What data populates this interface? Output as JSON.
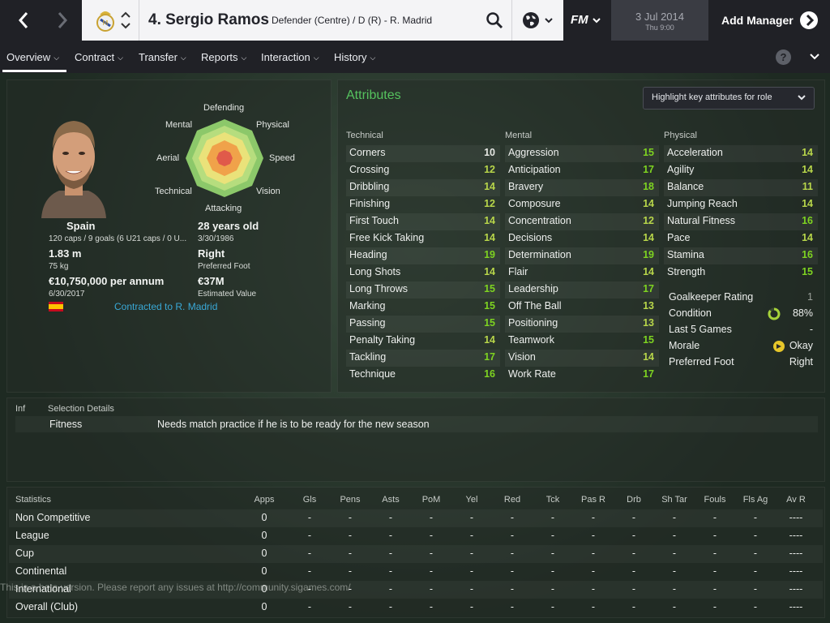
{
  "header": {
    "player_name": "4. Sergio Ramos",
    "position": "Defender (Centre) / D (R) - R. Madrid",
    "fm_logo": "FM",
    "date": "3 Jul 2014",
    "time": "Thu 9:00",
    "add_manager": "Add Manager"
  },
  "menu": [
    {
      "label": "Overview",
      "active": true
    },
    {
      "label": "Contract"
    },
    {
      "label": "Transfer"
    },
    {
      "label": "Reports"
    },
    {
      "label": "Interaction"
    },
    {
      "label": "History"
    }
  ],
  "help_label": "?",
  "profile": {
    "radar_labels": {
      "defending": "Defending",
      "physical": "Physical",
      "speed": "Speed",
      "vision": "Vision",
      "attacking": "Attacking",
      "technical": "Technical",
      "aerial": "Aerial",
      "mental": "Mental"
    },
    "nationality": "Spain",
    "caps": "120 caps / 9 goals (6 U21 caps / 0 U...",
    "height": "1.83 m",
    "weight": "75 kg",
    "wage": "€10,750,000 per annum",
    "contract_end": "6/30/2017",
    "age": "28 years old",
    "dob": "3/30/1986",
    "preferred_foot": "Right",
    "preferred_foot_label": "Preferred Foot",
    "value": "€37M",
    "value_label": "Estimated Value",
    "contracted": "Contracted to R. Madrid"
  },
  "attributes": {
    "title": "Attributes",
    "highlight_button": "Highlight key attributes for role",
    "technical": {
      "heading": "Technical",
      "items": [
        {
          "name": "Corners",
          "value": "10"
        },
        {
          "name": "Crossing",
          "value": "12"
        },
        {
          "name": "Dribbling",
          "value": "14"
        },
        {
          "name": "Finishing",
          "value": "12"
        },
        {
          "name": "First Touch",
          "value": "14"
        },
        {
          "name": "Free Kick Taking",
          "value": "14"
        },
        {
          "name": "Heading",
          "value": "19"
        },
        {
          "name": "Long Shots",
          "value": "14"
        },
        {
          "name": "Long Throws",
          "value": "15"
        },
        {
          "name": "Marking",
          "value": "15"
        },
        {
          "name": "Passing",
          "value": "15"
        },
        {
          "name": "Penalty Taking",
          "value": "14"
        },
        {
          "name": "Tackling",
          "value": "17"
        },
        {
          "name": "Technique",
          "value": "16"
        }
      ]
    },
    "mental": {
      "heading": "Mental",
      "items": [
        {
          "name": "Aggression",
          "value": "15"
        },
        {
          "name": "Anticipation",
          "value": "17"
        },
        {
          "name": "Bravery",
          "value": "18"
        },
        {
          "name": "Composure",
          "value": "14"
        },
        {
          "name": "Concentration",
          "value": "12"
        },
        {
          "name": "Decisions",
          "value": "14"
        },
        {
          "name": "Determination",
          "value": "19"
        },
        {
          "name": "Flair",
          "value": "14"
        },
        {
          "name": "Leadership",
          "value": "17"
        },
        {
          "name": "Off The Ball",
          "value": "13"
        },
        {
          "name": "Positioning",
          "value": "13"
        },
        {
          "name": "Teamwork",
          "value": "15"
        },
        {
          "name": "Vision",
          "value": "14"
        },
        {
          "name": "Work Rate",
          "value": "17"
        }
      ]
    },
    "physical": {
      "heading": "Physical",
      "items": [
        {
          "name": "Acceleration",
          "value": "14"
        },
        {
          "name": "Agility",
          "value": "14"
        },
        {
          "name": "Balance",
          "value": "11"
        },
        {
          "name": "Jumping Reach",
          "value": "14"
        },
        {
          "name": "Natural Fitness",
          "value": "16"
        },
        {
          "name": "Pace",
          "value": "14"
        },
        {
          "name": "Stamina",
          "value": "16"
        },
        {
          "name": "Strength",
          "value": "15"
        }
      ]
    },
    "summary": [
      {
        "name": "Goalkeeper Rating",
        "value": "1"
      },
      {
        "name": "Condition",
        "value": "88%"
      },
      {
        "name": "Last 5 Games",
        "value": "-"
      },
      {
        "name": "Morale",
        "value": "Okay"
      },
      {
        "name": "Preferred Foot",
        "value": "Right"
      }
    ]
  },
  "info": {
    "col1": "Inf",
    "col2": "Selection Details",
    "row_label": "Fitness",
    "row_text": "Needs match practice if he is to be ready for the new season"
  },
  "stats": {
    "title": "Statistics",
    "columns": [
      "Apps",
      "Gls",
      "Pens",
      "Asts",
      "PoM",
      "Yel",
      "Red",
      "Tck",
      "Pas R",
      "Drb",
      "Sh Tar",
      "Fouls",
      "Fls Ag",
      "Av R"
    ],
    "rows": [
      {
        "label": "Non Competitive",
        "cells": [
          "0",
          "-",
          "-",
          "-",
          "-",
          "-",
          "-",
          "-",
          "-",
          "-",
          "-",
          "-",
          "-",
          "----"
        ]
      },
      {
        "label": "League",
        "cells": [
          "0",
          "-",
          "-",
          "-",
          "-",
          "-",
          "-",
          "-",
          "-",
          "-",
          "-",
          "-",
          "-",
          "----"
        ]
      },
      {
        "label": "Cup",
        "cells": [
          "0",
          "-",
          "-",
          "-",
          "-",
          "-",
          "-",
          "-",
          "-",
          "-",
          "-",
          "-",
          "-",
          "----"
        ]
      },
      {
        "label": "Continental",
        "cells": [
          "0",
          "-",
          "-",
          "-",
          "-",
          "-",
          "-",
          "-",
          "-",
          "-",
          "-",
          "-",
          "-",
          "----"
        ]
      },
      {
        "label": "International",
        "cells": [
          "0",
          "-",
          "-",
          "-",
          "-",
          "-",
          "-",
          "-",
          "-",
          "-",
          "-",
          "-",
          "-",
          "----"
        ]
      },
      {
        "label": "Overall (Club)",
        "cells": [
          "0",
          "-",
          "-",
          "-",
          "-",
          "-",
          "-",
          "-",
          "-",
          "-",
          "-",
          "-",
          "-",
          "----"
        ]
      }
    ]
  },
  "watermark": "This is a beta version. Please report any issues at http://community.sigames.com/",
  "colors": {
    "accent_green": "#55c25e",
    "link_blue": "#39a8d6",
    "value_green": "#7ed321",
    "value_yellowgreen": "#b8d64a"
  }
}
